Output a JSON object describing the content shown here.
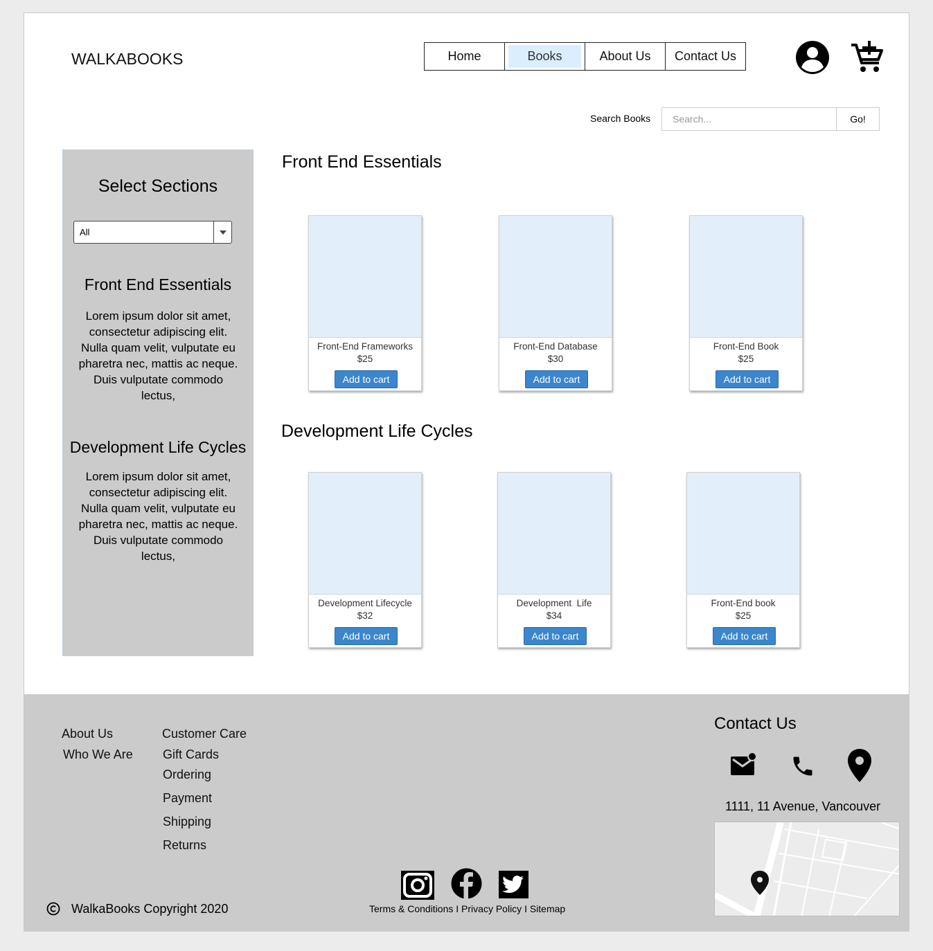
{
  "header": {
    "logo": "WALKABOOKS",
    "nav": [
      {
        "label": "Home"
      },
      {
        "label": "Books"
      },
      {
        "label": "About Us"
      },
      {
        "label": "Contact Us"
      }
    ],
    "active_nav": "Books",
    "icons": {
      "user": "user-circle-icon",
      "cart": "cart-add-icon"
    }
  },
  "search": {
    "label": "Search Books",
    "placeholder": "Search...",
    "button": "Go!"
  },
  "sidebar": {
    "title": "Select Sections",
    "select_value": "All",
    "sections": [
      {
        "heading": "Front End Essentials",
        "text": "Lorem ipsum dolor sit amet, consectetur adipiscing elit. Nulla quam velit, vulputate eu pharetra nec, mattis ac neque. Duis vulputate commodo lectus,"
      },
      {
        "heading": "Development Life Cycles",
        "text": "Lorem ipsum dolor sit amet, consectetur adipiscing elit. Nulla quam velit, vulputate eu pharetra nec, mattis ac neque. Duis vulputate commodo lectus,"
      }
    ]
  },
  "main": {
    "sections": [
      {
        "title": "Front End Essentials",
        "books": [
          {
            "title": "Front-End Frameworks",
            "price": "$25",
            "button": "Add to cart"
          },
          {
            "title": "Front-End Database",
            "price": "$30",
            "button": "Add to cart"
          },
          {
            "title": "Front-End Book",
            "price": "$25",
            "button": "Add to cart"
          }
        ]
      },
      {
        "title": "Development Life Cycles",
        "books": [
          {
            "title": "Development Lifecycle",
            "price": "$32",
            "button": "Add to cart"
          },
          {
            "title": "Development  Life",
            "price": "$34",
            "button": "Add to cart"
          },
          {
            "title": "Front-End book",
            "price": "$25",
            "button": "Add to cart"
          }
        ]
      }
    ]
  },
  "footer": {
    "col1": [
      "About Us",
      "Who We Are"
    ],
    "col2": [
      "Customer Care",
      "Gift Cards",
      "Ordering",
      "Payment",
      "Shipping",
      "Returns"
    ],
    "contact_title": "Contact Us",
    "contact_icons": [
      "mail-icon",
      "phone-icon",
      "location-pin-icon"
    ],
    "address": "1111, 11 Avenue, Vancouver",
    "social": [
      "instagram-icon",
      "facebook-icon",
      "twitter-icon"
    ],
    "legal": "Terms & Conditions I Privacy Policy I Sitemap",
    "copyright": "WalkaBooks Copyright 2020"
  }
}
